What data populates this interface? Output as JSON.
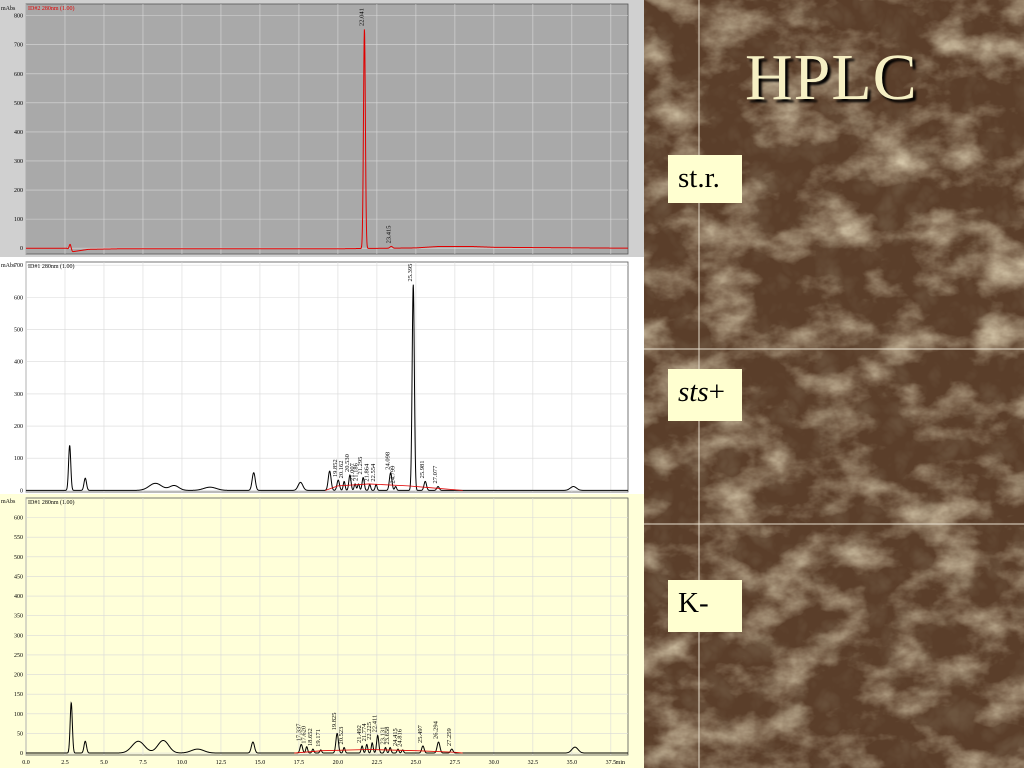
{
  "slide": {
    "title": "HPLC",
    "labels": {
      "str": "st.r.",
      "sts_italic": "sts",
      "sts_suffix": "+",
      "k": "K-"
    }
  },
  "colors": {
    "panel1_bg": "#a9a9a9",
    "panel2_bg": "#ffffff",
    "panel3_bg": "#ffffd9",
    "trace1": "#e00000",
    "trace2": "#000000",
    "baseline_red": "#e00000",
    "label_box": "#ffffd0",
    "title_text": "#f6f0c4"
  },
  "chart_data": [
    {
      "type": "line",
      "title": "ID#2 280nm (1.00)",
      "ylabel": "mAbs",
      "xlim": [
        0,
        38.6
      ],
      "ylim": [
        -20,
        840
      ],
      "yticks": [
        0,
        100,
        200,
        300,
        400,
        500,
        600,
        700,
        800
      ],
      "peaks": [
        {
          "x": 2.83,
          "y": 20,
          "w": 0.06
        },
        {
          "x": 21.7,
          "y": 755,
          "w": 0.06,
          "label": "22.041"
        },
        {
          "x": 23.42,
          "y": 6,
          "w": 0.08,
          "label": "23.415"
        }
      ],
      "baseline": [
        [
          0,
          0
        ],
        [
          2.6,
          0
        ],
        [
          3.0,
          -12
        ],
        [
          4.0,
          -4
        ],
        [
          6,
          -2
        ],
        [
          20,
          -2
        ],
        [
          25,
          1
        ],
        [
          26.5,
          6
        ],
        [
          28.5,
          6
        ],
        [
          30,
          3
        ],
        [
          38.6,
          0
        ]
      ]
    },
    {
      "type": "line",
      "title": "ID#1 280nm (1.00)",
      "ylabel": "mAbs",
      "xlim": [
        0,
        38.6
      ],
      "ylim": [
        -5,
        710
      ],
      "yticks": [
        0,
        100,
        200,
        300,
        400,
        500,
        600,
        700
      ],
      "peaks": [
        {
          "x": 2.8,
          "y": 140,
          "w": 0.07
        },
        {
          "x": 3.8,
          "y": 38,
          "w": 0.08
        },
        {
          "x": 8.3,
          "y": 22,
          "w": 0.4
        },
        {
          "x": 9.5,
          "y": 15,
          "w": 0.3
        },
        {
          "x": 11.8,
          "y": 10,
          "w": 0.4
        },
        {
          "x": 14.6,
          "y": 55,
          "w": 0.1
        },
        {
          "x": 17.6,
          "y": 25,
          "w": 0.15
        },
        {
          "x": 19.47,
          "y": 60,
          "w": 0.09
        },
        {
          "x": 20.02,
          "y": 32,
          "w": 0.08,
          "label": "19.852"
        },
        {
          "x": 20.4,
          "y": 28,
          "w": 0.06,
          "label": "20.162"
        },
        {
          "x": 20.77,
          "y": 48,
          "w": 0.07,
          "label": "20.530"
        },
        {
          "x": 21.1,
          "y": 20,
          "w": 0.06,
          "label": "21.007"
        },
        {
          "x": 21.32,
          "y": 20,
          "w": 0.06,
          "label": "21.186"
        },
        {
          "x": 21.62,
          "y": 40,
          "w": 0.07,
          "label": "21.295"
        },
        {
          "x": 22.04,
          "y": 18,
          "w": 0.06,
          "label": "21.864"
        },
        {
          "x": 22.45,
          "y": 18,
          "w": 0.06,
          "label": "22.554"
        },
        {
          "x": 23.38,
          "y": 55,
          "w": 0.08,
          "label": "24.098"
        },
        {
          "x": 23.7,
          "y": 12,
          "w": 0.06,
          "label": "24.799"
        },
        {
          "x": 24.83,
          "y": 640,
          "w": 0.07,
          "label": "25.395"
        },
        {
          "x": 25.6,
          "y": 28,
          "w": 0.08,
          "label": "25.981"
        },
        {
          "x": 26.42,
          "y": 12,
          "w": 0.08,
          "label": "27.077"
        },
        {
          "x": 35.1,
          "y": 12,
          "w": 0.2
        }
      ],
      "baseline": [
        [
          0,
          0
        ],
        [
          38.6,
          0
        ]
      ],
      "redline": [
        [
          19.2,
          0
        ],
        [
          20,
          14
        ],
        [
          22,
          20
        ],
        [
          24.5,
          14
        ],
        [
          26,
          8
        ],
        [
          27.5,
          2
        ],
        [
          28,
          0
        ]
      ]
    },
    {
      "type": "line",
      "title": "ID#1 280nm (1.00)",
      "ylabel": "mAbs",
      "xlabel": "min",
      "xlim": [
        0,
        38.6
      ],
      "ylim": [
        -5,
        650
      ],
      "yticks": [
        0,
        50,
        100,
        150,
        200,
        250,
        300,
        350,
        400,
        450,
        500,
        550,
        600
      ],
      "xticks": [
        0.0,
        2.5,
        5.0,
        7.5,
        10.0,
        12.5,
        15.0,
        17.5,
        20.0,
        22.5,
        25.0,
        27.5,
        30.0,
        32.5,
        35.0,
        37.5
      ],
      "peaks": [
        {
          "x": 2.9,
          "y": 128,
          "w": 0.07
        },
        {
          "x": 3.8,
          "y": 30,
          "w": 0.08
        },
        {
          "x": 7.2,
          "y": 30,
          "w": 0.4
        },
        {
          "x": 8.8,
          "y": 32,
          "w": 0.35
        },
        {
          "x": 11.0,
          "y": 10,
          "w": 0.4
        },
        {
          "x": 14.55,
          "y": 28,
          "w": 0.1
        },
        {
          "x": 17.65,
          "y": 22,
          "w": 0.08,
          "label": "17.337"
        },
        {
          "x": 18.0,
          "y": 16,
          "w": 0.06,
          "label": "17.620"
        },
        {
          "x": 18.4,
          "y": 10,
          "w": 0.06,
          "label": "18.652"
        },
        {
          "x": 18.9,
          "y": 8,
          "w": 0.06,
          "label": "19.171"
        },
        {
          "x": 19.95,
          "y": 50,
          "w": 0.08,
          "label": "19.825"
        },
        {
          "x": 20.4,
          "y": 14,
          "w": 0.06,
          "label": "20.523"
        },
        {
          "x": 21.55,
          "y": 18,
          "w": 0.06,
          "label": "21.492"
        },
        {
          "x": 21.85,
          "y": 22,
          "w": 0.06,
          "label": "21.774"
        },
        {
          "x": 22.2,
          "y": 26,
          "w": 0.06,
          "label": "22.225"
        },
        {
          "x": 22.55,
          "y": 45,
          "w": 0.07,
          "label": "22.411"
        },
        {
          "x": 23.05,
          "y": 14,
          "w": 0.06,
          "label": "23.131"
        },
        {
          "x": 23.35,
          "y": 14,
          "w": 0.06,
          "label": "23.658"
        },
        {
          "x": 23.85,
          "y": 10,
          "w": 0.06,
          "label": "24.415"
        },
        {
          "x": 24.15,
          "y": 8,
          "w": 0.06,
          "label": "24.816"
        },
        {
          "x": 25.45,
          "y": 18,
          "w": 0.08,
          "label": "25.497"
        },
        {
          "x": 26.45,
          "y": 28,
          "w": 0.09,
          "label": "26.294"
        },
        {
          "x": 27.3,
          "y": 10,
          "w": 0.08,
          "label": "27.259"
        },
        {
          "x": 35.2,
          "y": 15,
          "w": 0.2
        }
      ],
      "baseline": [
        [
          0,
          0
        ],
        [
          38.6,
          0
        ]
      ],
      "redline": [
        [
          17.2,
          0
        ],
        [
          19,
          6
        ],
        [
          22,
          9
        ],
        [
          25,
          6
        ],
        [
          27.5,
          2
        ],
        [
          28,
          0
        ]
      ]
    }
  ]
}
